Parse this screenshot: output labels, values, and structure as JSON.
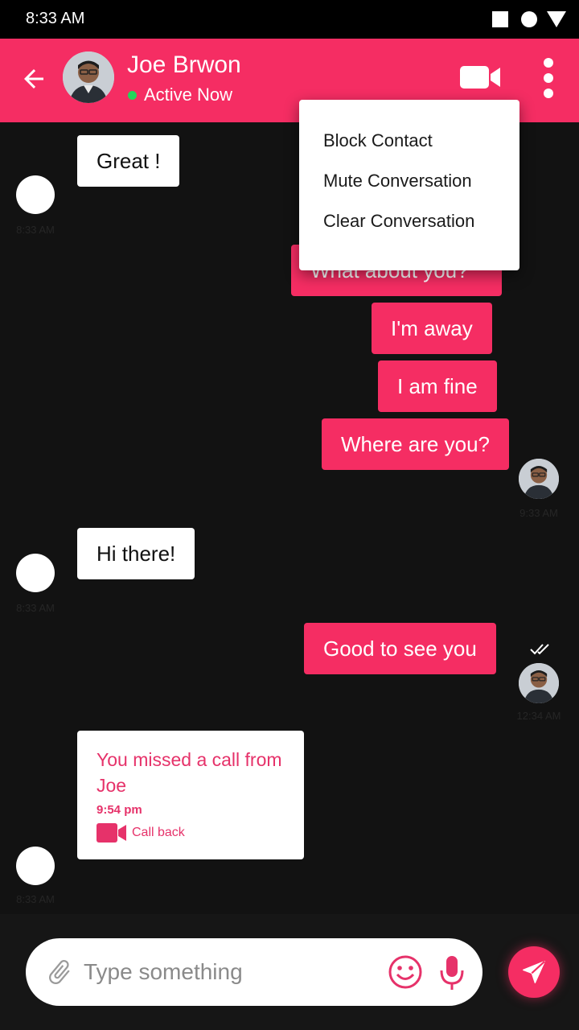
{
  "status_bar": {
    "time": "8:33 AM"
  },
  "header": {
    "contact_name": "Joe Brwon",
    "presence": "Active Now"
  },
  "menu": {
    "items": [
      "Block Contact",
      "Mute Conversation",
      "Clear Conversation"
    ]
  },
  "messages": [
    {
      "dir": "in",
      "text": "Great !",
      "time": "8:33 AM"
    },
    {
      "dir": "out",
      "text": "What about you?"
    },
    {
      "dir": "out",
      "text": "I'm away"
    },
    {
      "dir": "out",
      "text": "I am fine"
    },
    {
      "dir": "out",
      "text": "Where are you?",
      "time": "9:33 AM"
    },
    {
      "dir": "in",
      "text": "Hi there!",
      "time": "8:33 AM"
    },
    {
      "dir": "out",
      "text": "Good to see you",
      "time": "12:34 AM",
      "status": "read"
    }
  ],
  "missed_call": {
    "title": "You missed a call from Joe",
    "time": "9:54 pm",
    "action": "Call back",
    "stamp": "8:33 AM"
  },
  "composer": {
    "placeholder": "Type something"
  },
  "colors": {
    "primary": "#F52D63",
    "background": "#121212",
    "presence": "#22D65A"
  },
  "icons": [
    "back-arrow-icon",
    "video-call-icon",
    "more-vert-icon",
    "attach-icon",
    "emoji-icon",
    "mic-icon",
    "send-icon",
    "double-check-icon"
  ]
}
